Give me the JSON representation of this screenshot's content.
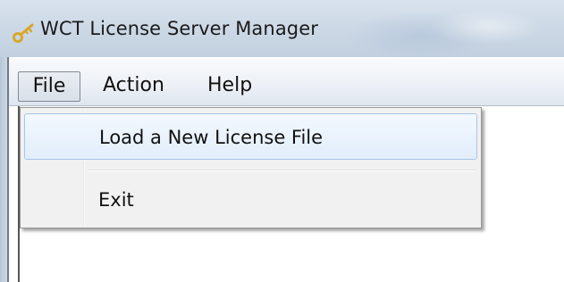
{
  "window": {
    "title": "WCT License Server Manager",
    "icon": "key-icon"
  },
  "menubar": {
    "items": [
      {
        "label": "File",
        "active": true
      },
      {
        "label": "Action"
      },
      {
        "label": "Help"
      }
    ]
  },
  "file_menu": {
    "items": [
      {
        "label": "Load a New License File",
        "highlighted": true
      },
      {
        "label": "Exit"
      }
    ]
  },
  "colors": {
    "highlight_border": "#a8c6e8",
    "highlight_fill": "#e2eefb",
    "menu_background": "#f1f1f1",
    "key_icon": "#d9a62a"
  }
}
